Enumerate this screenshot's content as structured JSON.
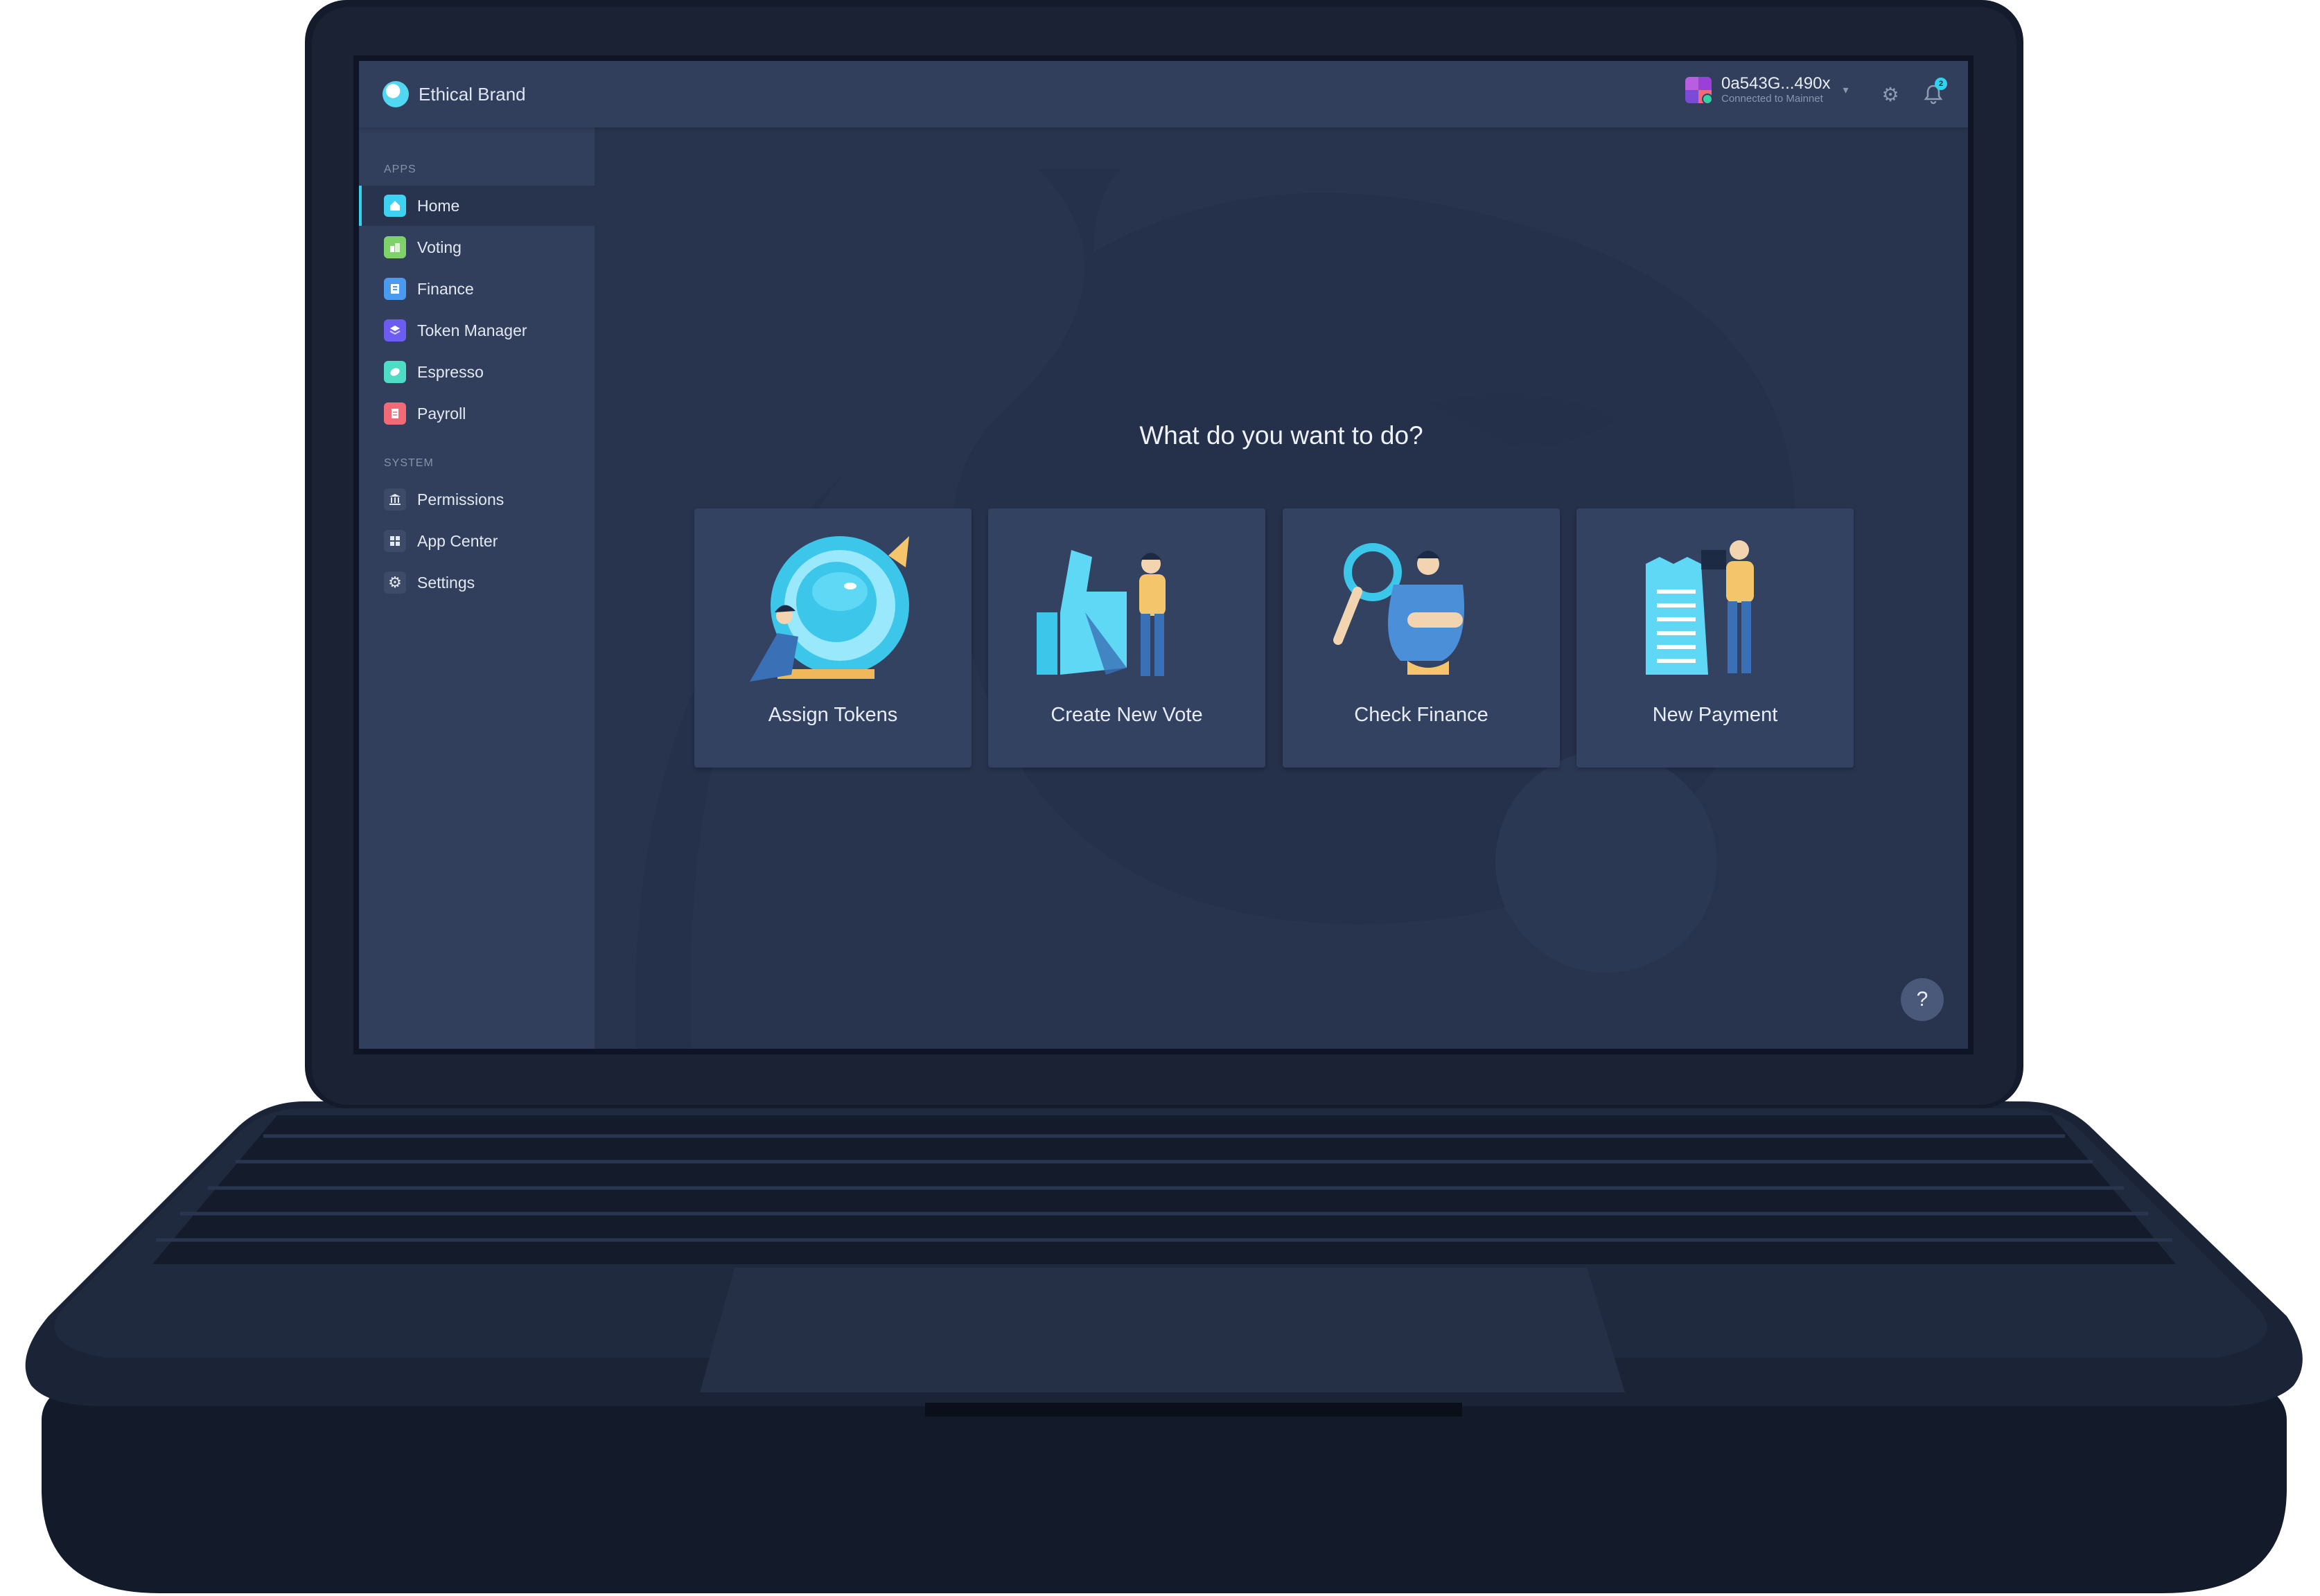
{
  "header": {
    "org_name": "Ethical Brand",
    "account": {
      "address": "0a543G...490x",
      "network": "Connected to Mainnet"
    },
    "notification_count": "2"
  },
  "sidebar": {
    "apps_heading": "APPS",
    "apps": [
      {
        "label": "Home",
        "icon": "home-icon",
        "color": "#3fd2f0",
        "active": true
      },
      {
        "label": "Voting",
        "icon": "voting-icon",
        "color": "#7fd16a"
      },
      {
        "label": "Finance",
        "icon": "finance-icon",
        "color": "#4a9bf0"
      },
      {
        "label": "Token Manager",
        "icon": "token-manager-icon",
        "color": "#6d5cf2"
      },
      {
        "label": "Espresso",
        "icon": "espresso-icon",
        "color": "#4fdcc4"
      },
      {
        "label": "Payroll",
        "icon": "payroll-icon",
        "color": "#f06a78"
      }
    ],
    "system_heading": "SYSTEM",
    "system": [
      {
        "label": "Permissions",
        "icon": "permissions-icon"
      },
      {
        "label": "App Center",
        "icon": "app-center-icon"
      },
      {
        "label": "Settings",
        "icon": "settings-icon"
      }
    ]
  },
  "main": {
    "title": "What do you want to do?",
    "actions": [
      {
        "label": "Assign Tokens",
        "illustration": "crystal-ball-illustration"
      },
      {
        "label": "Create New Vote",
        "illustration": "thumbs-up-illustration"
      },
      {
        "label": "Check Finance",
        "illustration": "magnifier-illustration"
      },
      {
        "label": "New Payment",
        "illustration": "receipt-illustration"
      }
    ],
    "help_label": "?"
  }
}
